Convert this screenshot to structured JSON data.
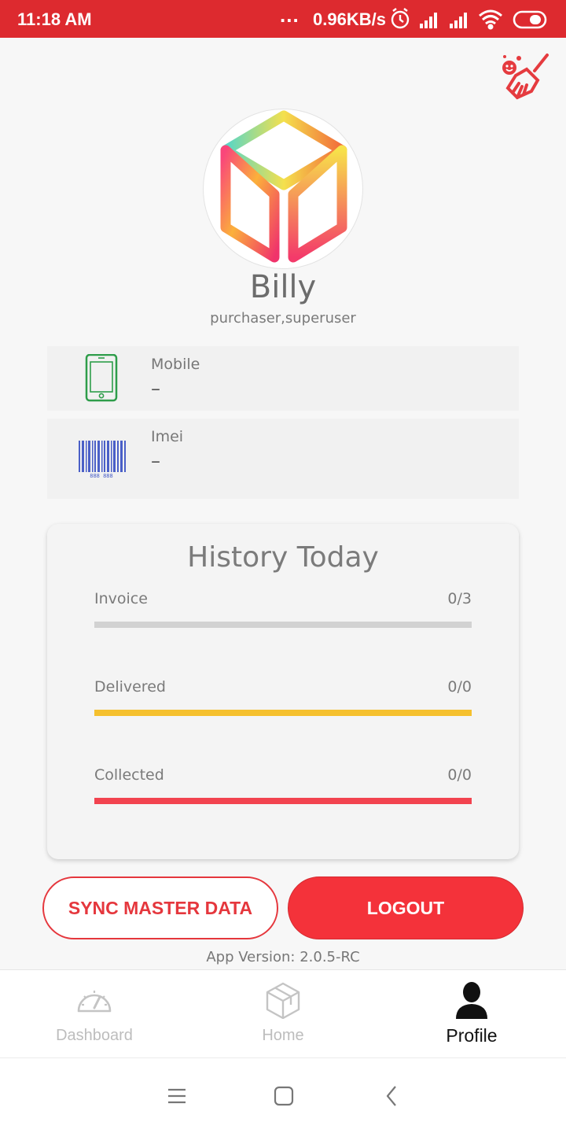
{
  "status_bar": {
    "time": "11:18 AM",
    "dots": "...",
    "speed": "0.96KB/s",
    "icons": [
      "alarm-icon",
      "signal-icon",
      "signal-icon",
      "wifi-icon",
      "battery-icon"
    ]
  },
  "profile": {
    "name": "Billy",
    "roles": "purchaser,superuser"
  },
  "info": {
    "mobile_label": "Mobile",
    "mobile_value": "–",
    "imei_label": "Imei",
    "imei_value": "–",
    "barcode_text": "888 888"
  },
  "history": {
    "title": "History Today",
    "rows": [
      {
        "label": "Invoice",
        "value": "0/3",
        "color": "#cfcfcf",
        "fraction": 0
      },
      {
        "label": "Delivered",
        "value": "0/0",
        "color": "#f5c02e",
        "fraction": 1
      },
      {
        "label": "Collected",
        "value": "0/0",
        "color": "#f2434f",
        "fraction": 1
      }
    ]
  },
  "buttons": {
    "sync": "SYNC MASTER DATA",
    "logout": "LOGOUT"
  },
  "app_version": "App Version: 2.0.5-RC",
  "nav": {
    "dashboard": "Dashboard",
    "home": "Home",
    "profile": "Profile"
  },
  "colors": {
    "brand_red": "#dd2a2f",
    "accent_red": "#f4323a",
    "delivered": "#f5c02e",
    "collected": "#f2434f",
    "mobile_icon": "#2e9d4a",
    "barcode": "#4a5fc7"
  }
}
